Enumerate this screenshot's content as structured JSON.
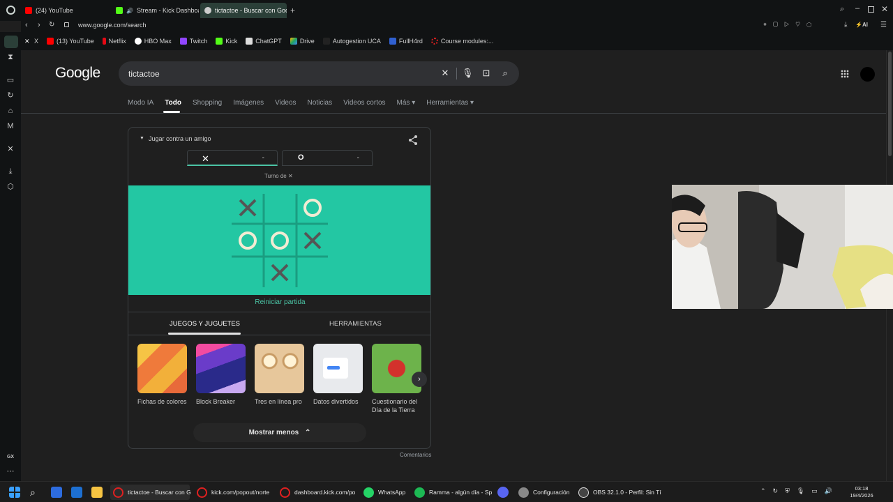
{
  "browser": {
    "tabs": [
      {
        "label": "(24) YouTube",
        "color": "#ff0000"
      },
      {
        "label": "Stream - Kick Dashboard",
        "color": "#53fc18"
      },
      {
        "label": "tictactoe - Buscar con Google",
        "color": "#cccccc"
      }
    ],
    "url": "www.google.com/search",
    "bookmarks": [
      {
        "label": "X",
        "color": "#ffffff"
      },
      {
        "label": "(13) YouTube",
        "color": "#ff0000"
      },
      {
        "label": "Netflix",
        "color": "#e50914"
      },
      {
        "label": "HBO Max",
        "color": "#ffffff"
      },
      {
        "label": "Twitch",
        "color": "#9146ff"
      },
      {
        "label": "Kick",
        "color": "#53fc18"
      },
      {
        "label": "ChatGPT",
        "color": "#dddddd"
      },
      {
        "label": "Drive",
        "color": "#1fa463"
      },
      {
        "label": "Autogestion UCA",
        "color": "#222222"
      },
      {
        "label": "FullH4rd",
        "color": "#3060d0"
      },
      {
        "label": "Course modules:...",
        "color": "#e02020"
      }
    ]
  },
  "search": {
    "logo": "Google",
    "query": "tictactoe",
    "tabs": [
      "Modo IA",
      "Todo",
      "Shopping",
      "Imágenes",
      "Videos",
      "Noticias",
      "Videos cortos",
      "Más ▾",
      "Herramientas ▾"
    ]
  },
  "game": {
    "mode_label": "Jugar contra un amigo",
    "player_x": {
      "symbol": "✕",
      "score": "-"
    },
    "player_o": {
      "symbol": "O",
      "score": "-"
    },
    "turn_label": "Turno de ✕",
    "board": [
      "X",
      "",
      "O",
      "O",
      "O",
      "X",
      "",
      "X",
      ""
    ],
    "board_color": "#23c7a3",
    "reset_label": "Reiniciar partida",
    "tab_games": "JUEGOS Y JUGUETES",
    "tab_tools": "HERRAMIENTAS",
    "games": [
      {
        "label": "Fichas de colores"
      },
      {
        "label": "Block Breaker"
      },
      {
        "label": "Tres en línea pro"
      },
      {
        "label": "Datos divertidos"
      },
      {
        "label": "Cuestionario del Día de la Tierra"
      }
    ],
    "show_less": "Mostrar menos",
    "feedback": "Comentarios"
  },
  "taskbar": {
    "items": [
      {
        "label": "tictactoe - Buscar con G",
        "color": "#e02020"
      },
      {
        "label": "kick.com/popout/norte",
        "color": "#e02020"
      },
      {
        "label": "dashboard.kick.com/po",
        "color": "#e02020"
      },
      {
        "label": "WhatsApp",
        "color": "#25d366"
      },
      {
        "label": "Ramma - algún día - Sp",
        "color": "#1db954"
      },
      {
        "label": "Configuración",
        "color": "#888888"
      },
      {
        "label": "OBS 32.1.0 - Perfil: Sin Tí",
        "color": "#444444"
      }
    ],
    "time": "03:18",
    "date": "19/4/2026"
  },
  "sidebar_footer": "GX"
}
